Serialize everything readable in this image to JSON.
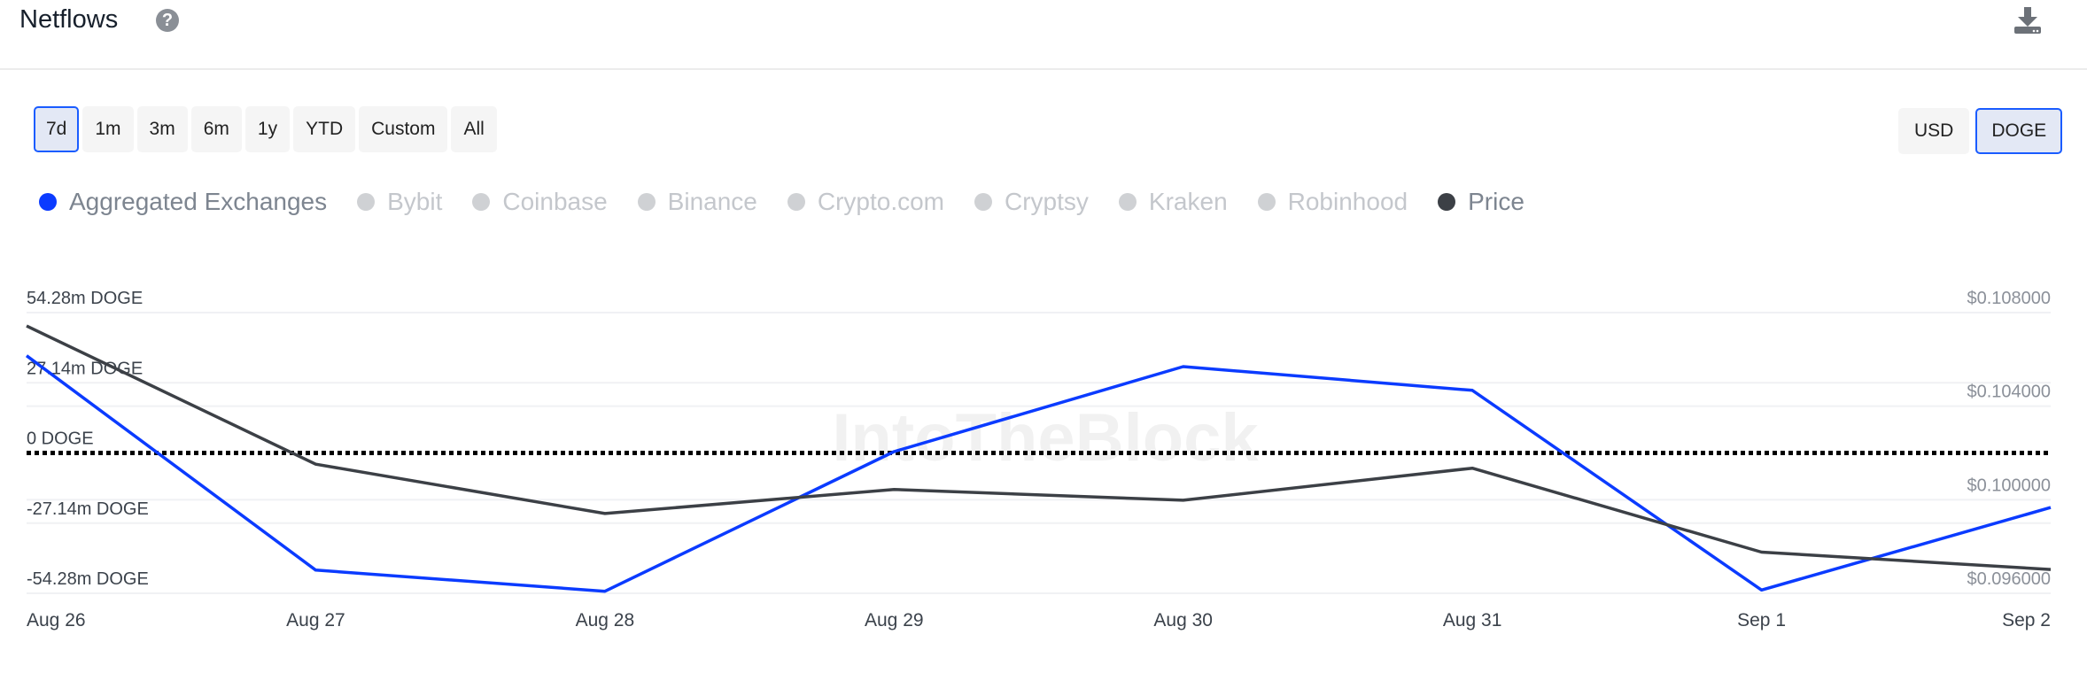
{
  "header": {
    "title": "Netflows",
    "help_icon": "question-circle-icon",
    "download_icon": "download-icon"
  },
  "ranges": [
    {
      "label": "7d",
      "active": true
    },
    {
      "label": "1m",
      "active": false
    },
    {
      "label": "3m",
      "active": false
    },
    {
      "label": "6m",
      "active": false
    },
    {
      "label": "1y",
      "active": false
    },
    {
      "label": "YTD",
      "active": false
    },
    {
      "label": "Custom",
      "active": false
    },
    {
      "label": "All",
      "active": false
    }
  ],
  "currency": [
    {
      "label": "USD",
      "active": false
    },
    {
      "label": "DOGE",
      "active": true
    }
  ],
  "legend": [
    {
      "label": "Aggregated Exchanges",
      "color": "#0b3bff",
      "enabled": true
    },
    {
      "label": "Bybit",
      "color": "#cfd1d4",
      "enabled": false
    },
    {
      "label": "Coinbase",
      "color": "#cfd1d4",
      "enabled": false
    },
    {
      "label": "Binance",
      "color": "#cfd1d4",
      "enabled": false
    },
    {
      "label": "Crypto.com",
      "color": "#cfd1d4",
      "enabled": false
    },
    {
      "label": "Cryptsy",
      "color": "#cfd1d4",
      "enabled": false
    },
    {
      "label": "Kraken",
      "color": "#cfd1d4",
      "enabled": false
    },
    {
      "label": "Robinhood",
      "color": "#cfd1d4",
      "enabled": false
    },
    {
      "label": "Price",
      "color": "#3c4046",
      "enabled": true
    }
  ],
  "watermark": "IntoTheBlock",
  "chart_data": {
    "type": "line",
    "categories": [
      "Aug 26",
      "Aug 27",
      "Aug 28",
      "Aug 29",
      "Aug 30",
      "Aug 31",
      "Sep 1",
      "Sep 2"
    ],
    "series": [
      {
        "name": "Aggregated Exchanges",
        "axis": "left",
        "color": "#0b3bff",
        "values": [
          37.6,
          -45.3,
          -53.5,
          0.5,
          33.4,
          24.2,
          -53.0,
          -21.1
        ]
      },
      {
        "name": "Price",
        "axis": "right",
        "color": "#3c4046",
        "values": [
          0.10743,
          0.10152,
          0.09941,
          0.10044,
          0.09998,
          0.10135,
          0.09776,
          0.09702
        ]
      }
    ],
    "left_axis": {
      "unit": "m DOGE",
      "ylim": [
        -54.28,
        54.28
      ],
      "ticks": [
        54.28,
        27.14,
        0,
        -27.14,
        -54.28
      ],
      "tick_labels": [
        "54.28m DOGE",
        "27.14m DOGE",
        "0 DOGE",
        "-27.14m DOGE",
        "-54.28m DOGE"
      ]
    },
    "right_axis": {
      "ylim": [
        0.096,
        0.108
      ],
      "ticks": [
        0.108,
        0.104,
        0.1,
        0.096
      ],
      "tick_labels": [
        "$0.108000",
        "$0.104000",
        "$0.100000",
        "$0.096000"
      ]
    },
    "zero_line": "dotted",
    "grid": true
  }
}
